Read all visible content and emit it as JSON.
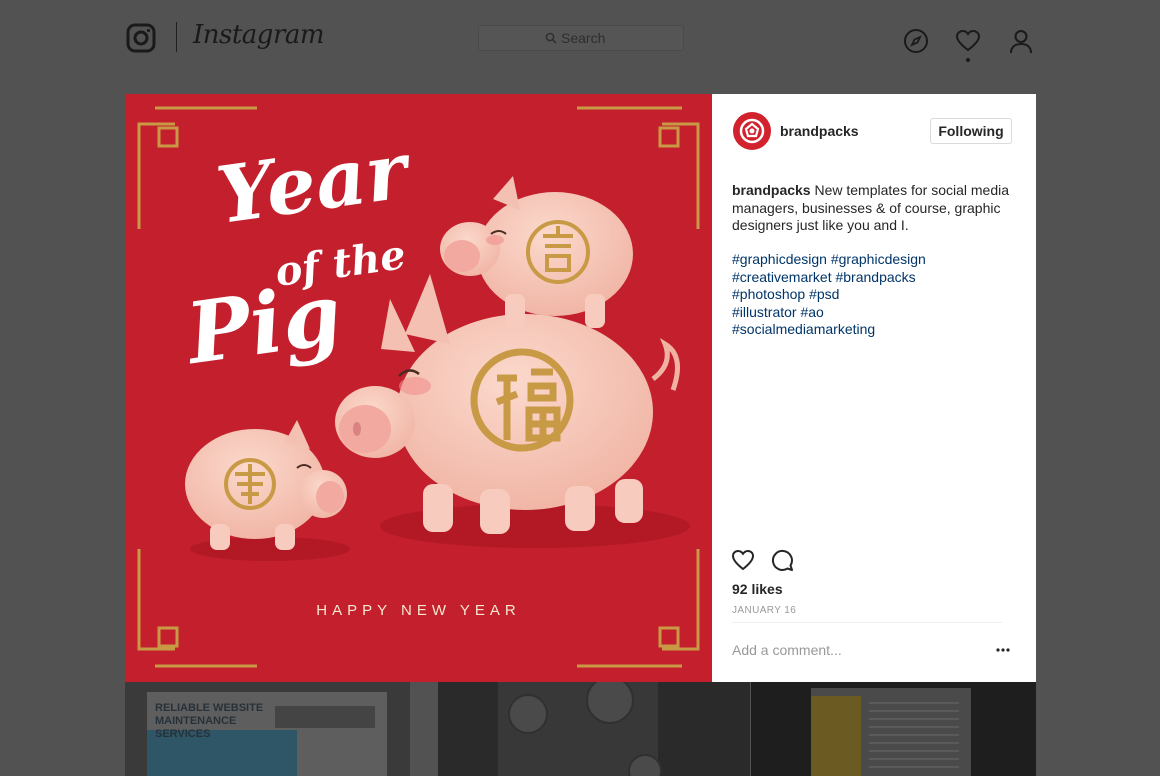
{
  "nav": {
    "wordmark": "Instagram",
    "search_placeholder": "Search",
    "icons": [
      "instagram-logo-icon",
      "search-icon",
      "compass-icon",
      "heart-icon",
      "user-icon"
    ]
  },
  "post": {
    "image": {
      "title_line1": "Year",
      "title_line2": "of the",
      "title_line3": "Pig",
      "subtitle": "HAPPY NEW YEAR"
    },
    "author": {
      "username": "brandpacks",
      "follow_label": "Following"
    },
    "caption": {
      "username": "brandpacks",
      "text": "New templates for social media managers, businesses & of course, graphic designers just like you and I."
    },
    "hashtags": [
      [
        "#graphicdesign",
        "#graphicdesign"
      ],
      [
        "#creativemarket",
        "#brandpacks"
      ],
      [
        "#photoshop",
        "#psd"
      ],
      [
        "#illustrator",
        "#ao"
      ],
      [
        "#socialmediamarketing"
      ]
    ],
    "likes": "92 likes",
    "date": "JANUARY 16",
    "comment_placeholder": "Add a comment..."
  },
  "grid": {
    "thumb1_text": "RELIABLE WEBSITE MAINTENANCE SERVICES"
  },
  "colors": {
    "overlay": "#525252",
    "post_red": "#c31f2c",
    "hashtag_blue": "#003569",
    "text_dark": "#262626",
    "muted": "#999999"
  }
}
